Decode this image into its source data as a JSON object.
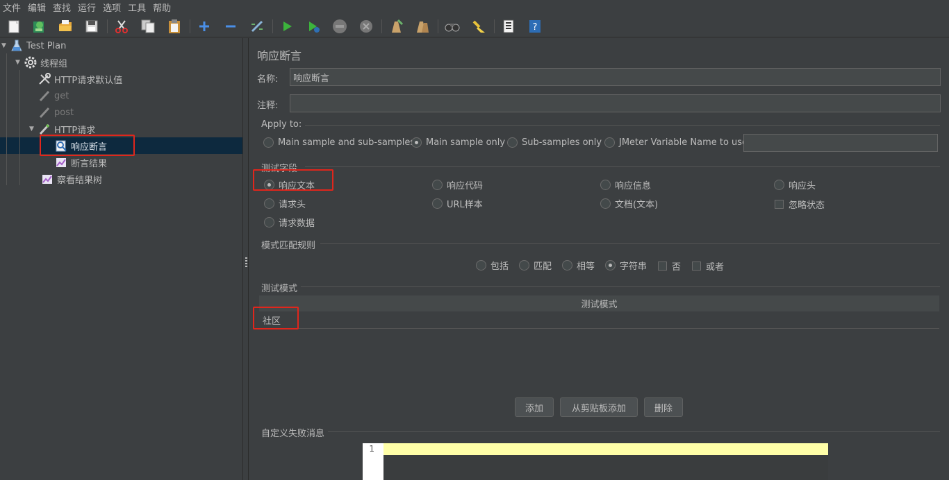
{
  "menu": [
    "文件",
    "编辑",
    "查找",
    "运行",
    "选项",
    "工具",
    "帮助"
  ],
  "toolbar": {
    "icons": [
      "new-icon",
      "templates-icon",
      "open-icon",
      "save-icon",
      "cut-icon",
      "copy-icon",
      "paste-icon",
      "expand-icon",
      "collapse-icon",
      "toggle-icon",
      "start-icon",
      "start-no-pause-icon",
      "stop-icon",
      "shutdown-icon",
      "clear-icon",
      "clear-all-icon",
      "search-icon",
      "reset-search-icon",
      "function-helper-icon",
      "help-icon"
    ]
  },
  "tree": {
    "items": [
      {
        "label": "Test Plan"
      },
      {
        "label": "线程组"
      },
      {
        "label": "HTTP请求默认值"
      },
      {
        "label": "get"
      },
      {
        "label": "post"
      },
      {
        "label": "HTTP请求"
      },
      {
        "label": "响应断言"
      },
      {
        "label": "断言结果"
      },
      {
        "label": "察看结果树"
      }
    ]
  },
  "panel": {
    "title": "响应断言",
    "name_label": "名称:",
    "name_value": "响应断言",
    "comment_label": "注释:",
    "comment_value": "",
    "apply_to": {
      "label": "Apply to:",
      "options": [
        "Main sample and sub-samples",
        "Main sample only",
        "Sub-samples only",
        "JMeter Variable Name to use"
      ],
      "selected": "Main sample only",
      "variable_value": ""
    },
    "field_to_test": {
      "label": "测试字段",
      "options": [
        "响应文本",
        "响应代码",
        "响应信息",
        "响应头",
        "请求头",
        "URL样本",
        "文档(文本)",
        "请求数据"
      ],
      "selected": "响应文本",
      "ignore_status_label": "忽略状态"
    },
    "pattern_matching": {
      "label": "模式匹配规则",
      "options": [
        "包括",
        "匹配",
        "相等",
        "字符串"
      ],
      "selected": "字符串",
      "not_label": "否",
      "or_label": "或者"
    },
    "patterns": {
      "label": "测试模式",
      "column_header": "测试模式",
      "rows": [
        "社区"
      ]
    },
    "buttons": {
      "add": "添加",
      "add_from_clipboard": "从剪贴板添加",
      "delete": "删除"
    },
    "custom_failure": {
      "label": "自定义失败消息",
      "line_number": "1"
    }
  },
  "colors": {
    "background": "#3c3f41",
    "selection": "#0d293e",
    "highlight_box": "#e0261c",
    "editor_line": "#ffffa8"
  }
}
